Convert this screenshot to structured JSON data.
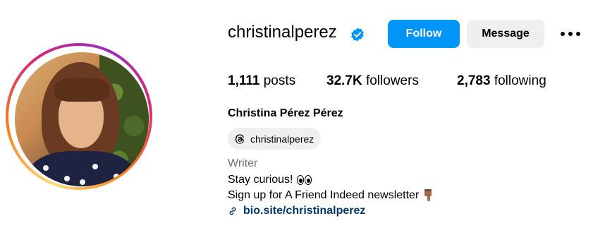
{
  "profile": {
    "username": "christinalperez",
    "verified": true,
    "full_name": "Christina Pérez Pérez",
    "threads_handle": "christinalperez",
    "category": "Writer",
    "bio_line1": "Stay curious!",
    "bio_line2": "Sign up for A Friend Indeed newsletter",
    "link": "bio.site/christinalperez"
  },
  "actions": {
    "follow_label": "Follow",
    "message_label": "Message"
  },
  "stats": {
    "posts_count": "1,111",
    "posts_label": "posts",
    "followers_count": "32.7K",
    "followers_label": "followers",
    "following_count": "2,783",
    "following_label": "following"
  },
  "icons": {
    "verified": "verified-badge-icon",
    "more": "more-options-icon",
    "threads": "threads-icon",
    "eyes": "eyes-emoji-icon",
    "hand": "pointing-down-hand-icon",
    "link": "link-icon"
  },
  "colors": {
    "follow_button": "#0095f6",
    "message_button": "#efefef",
    "link_text": "#00376b",
    "category_text": "#737373",
    "verified_badge": "#0095f6"
  }
}
